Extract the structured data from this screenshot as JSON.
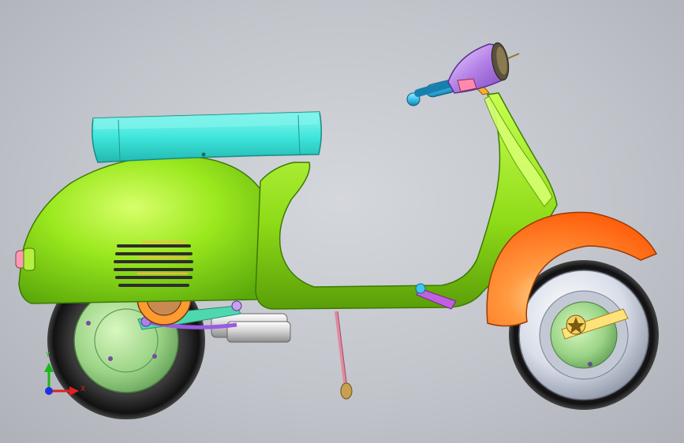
{
  "viewport": {
    "model": "scooter-assembly",
    "colors": {
      "background": "#c5c8ce",
      "body_green": "#8fe01a",
      "seat_cyan": "#38e0d8",
      "fender_orange": "#ff6a10",
      "tire": "#1e1e1e",
      "hub_green": "#9fd58a",
      "headlight_purple": "#b083e0",
      "grip_blue": "#3ec6ee",
      "kickstand_pink": "#e08aa0",
      "exhaust_silver": "#d8d8d8"
    }
  },
  "triad": {
    "x_label": "X",
    "y_label": "Y",
    "x_color": "#e02020",
    "y_color": "#18b818",
    "z_color": "#2030e0"
  }
}
